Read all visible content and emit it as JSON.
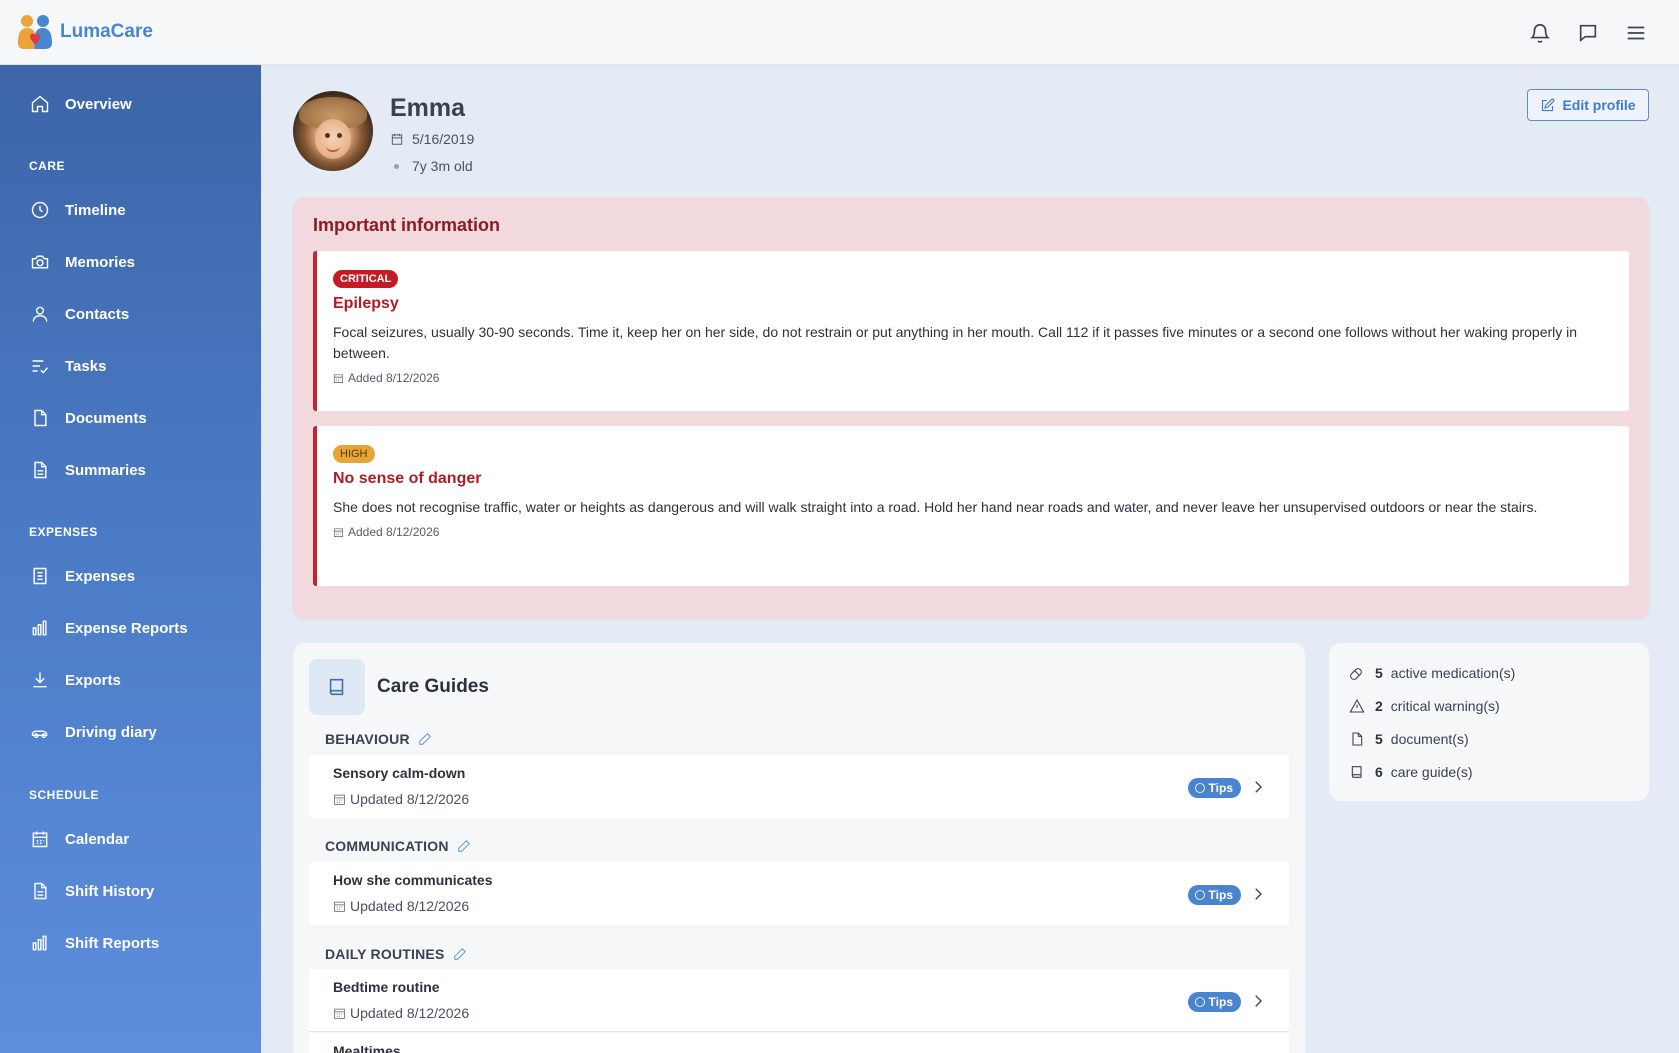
{
  "app": {
    "name": "LumaCare"
  },
  "sidebar": {
    "overview": "Overview",
    "sections": {
      "care": "CARE",
      "expenses": "EXPENSES",
      "schedule": "SCHEDULE"
    },
    "care_items": [
      "Timeline",
      "Memories",
      "Contacts",
      "Tasks",
      "Documents",
      "Summaries"
    ],
    "expense_items": [
      "Expenses",
      "Expense Reports",
      "Exports",
      "Driving diary"
    ],
    "schedule_items": [
      "Calendar",
      "Shift History",
      "Shift Reports"
    ]
  },
  "profile": {
    "name": "Emma",
    "birthdate": "5/16/2019",
    "age": "7y 3m old",
    "edit_label": "Edit profile"
  },
  "important": {
    "title": "Important information",
    "alerts": [
      {
        "severity": "CRITICAL",
        "title": "Epilepsy",
        "body": "Focal seizures, usually 30-90 seconds. Time it, keep her on her side, do not restrain or put anything in her mouth. Call 112 if it passes five minutes or a second one follows without her waking properly in between.",
        "date": "Added 8/12/2026"
      },
      {
        "severity": "HIGH",
        "title": "No sense of danger",
        "body": "She does not recognise traffic, water or heights as dangerous and will walk straight into a road. Hold her hand near roads and water, and never leave her unsupervised outdoors or near the stairs.",
        "date": "Added 8/12/2026"
      }
    ]
  },
  "care_guides": {
    "title": "Care Guides",
    "tips_label": "Tips",
    "categories": [
      {
        "name": "BEHAVIOUR",
        "guides": [
          {
            "name": "Sensory calm-down",
            "date": "Updated 8/12/2026"
          }
        ]
      },
      {
        "name": "COMMUNICATION",
        "guides": [
          {
            "name": "How she communicates",
            "date": "Updated 8/12/2026"
          }
        ]
      },
      {
        "name": "DAILY ROUTINES",
        "guides": [
          {
            "name": "Bedtime routine",
            "date": "Updated 8/12/2026"
          },
          {
            "name": "Mealtimes",
            "date": ""
          }
        ]
      }
    ]
  },
  "stats": [
    {
      "count": "5",
      "label": "active medication(s)",
      "icon": "pill-icon"
    },
    {
      "count": "2",
      "label": "critical warning(s)",
      "icon": "warning-icon"
    },
    {
      "count": "5",
      "label": "document(s)",
      "icon": "document-icon"
    },
    {
      "count": "6",
      "label": "care guide(s)",
      "icon": "book-icon"
    }
  ]
}
